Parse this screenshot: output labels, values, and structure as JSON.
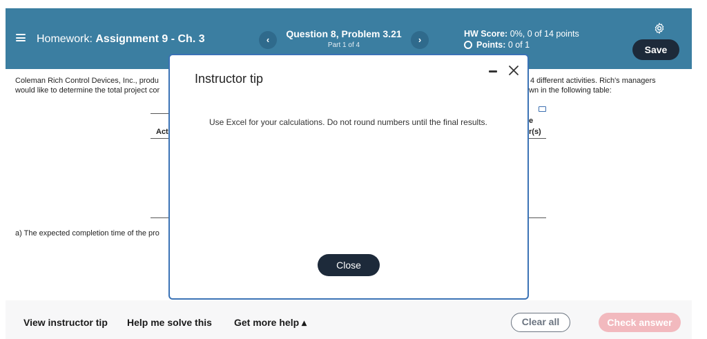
{
  "header": {
    "hw_prefix": "Homework:",
    "hw_name": "Assignment 9 - Ch. 3",
    "question_title": "Question 8, Problem 3.21",
    "question_part": "Part 1 of 4",
    "prev_icon": "chevron-left-icon",
    "next_icon": "chevron-right-icon",
    "prev_glyph": "‹",
    "next_glyph": "›",
    "hw_score_label": "HW Score:",
    "hw_score_value": "0%, 0 of 14 points",
    "points_label": "Points:",
    "points_value": "0 of 1",
    "save_label": "Save",
    "accent_color": "#3b7ea1"
  },
  "background": {
    "intro_line1_left": "Coleman Rich Control Devices, Inc., produ",
    "intro_line2_left": "would like to determine the total project cor",
    "intro_line1_right": "4 different activities. Rich's managers",
    "intro_line2_right": "wn in the following table:",
    "table_header_left": "Act",
    "table_header_right_top": "e",
    "table_header_right_bottom": "r(s)",
    "question_a": "a) The expected completion time of the pro"
  },
  "modal": {
    "title": "Instructor tip",
    "tip_text": "Use Excel for your calculations. Do not round numbers until the final results.",
    "close_label": "Close",
    "border_color": "#3a72b5"
  },
  "footer": {
    "view_tip": "View instructor tip",
    "help_solve": "Help me solve this",
    "get_more_help": "Get more help ▴",
    "clear_all": "Clear all",
    "check_answer": "Check answer",
    "check_color": "#f2b9be"
  }
}
